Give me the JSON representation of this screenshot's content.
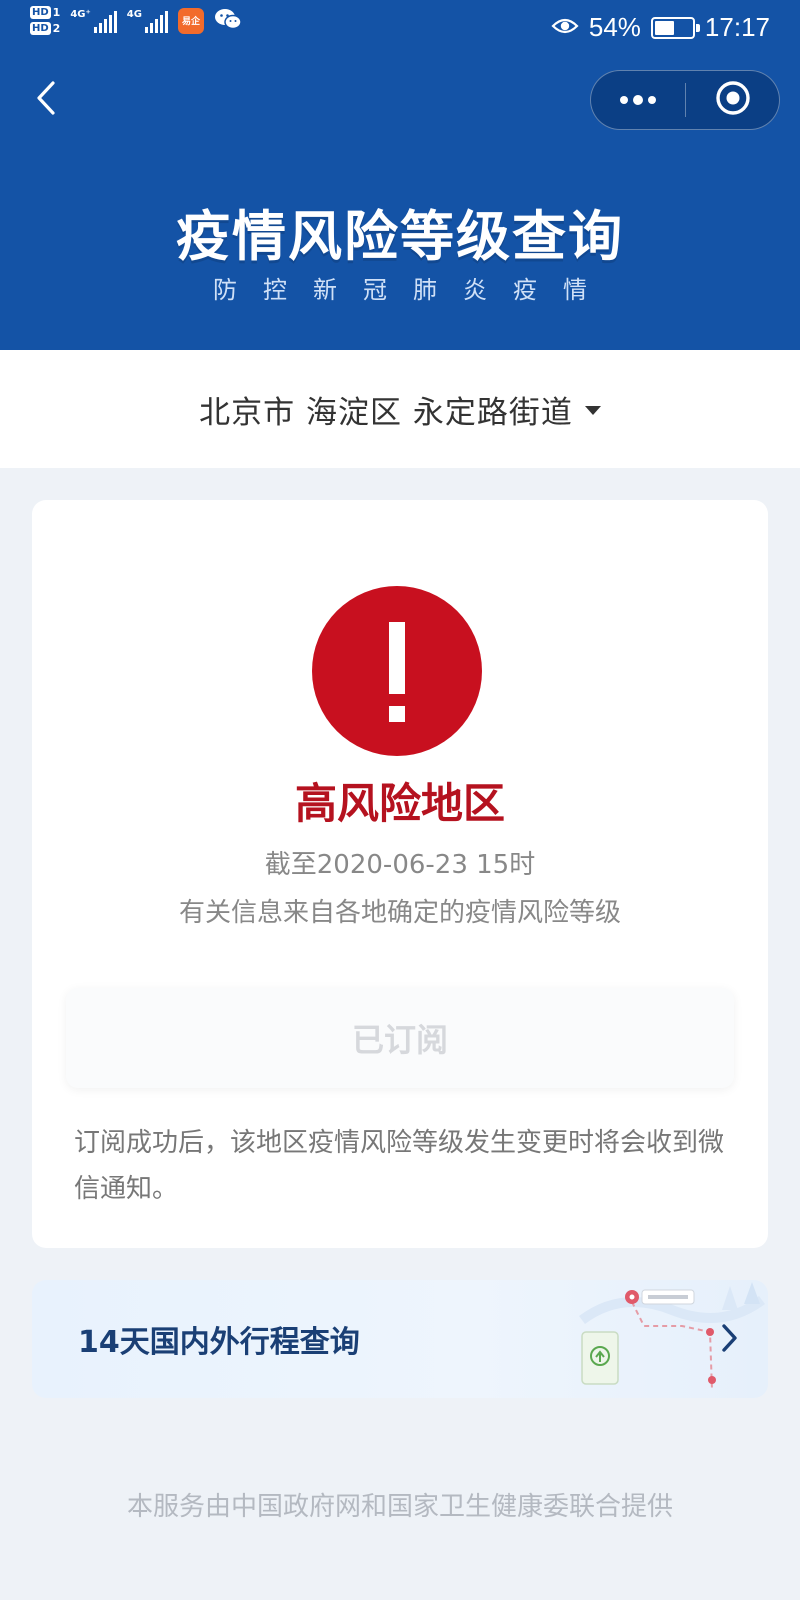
{
  "status_bar": {
    "hd1": "HD",
    "hd1_slot": "1",
    "hd2": "HD",
    "hd2_slot": "2",
    "signal1_label": "4G⁺",
    "signal2_label": "4G",
    "app_badge": "易企",
    "battery_percent": "54%",
    "battery_level": 0.54,
    "time": "17:17"
  },
  "nav": {
    "back_icon": "chevron-left-icon",
    "more_icon": "more-dots-icon",
    "close_icon": "target-close-icon"
  },
  "banner": {
    "title": "疫情风险等级查询",
    "subtitle": "防控新冠肺炎疫情"
  },
  "location": {
    "text": "北京市 海淀区 永定路街道"
  },
  "risk": {
    "icon": "exclamation-icon",
    "level": "高风险地区",
    "time": "截至2020-06-23 15时",
    "source": "有关信息来自各地确定的疫情风险等级",
    "subscribe_label": "已订阅",
    "note": "订阅成功后，该地区疫情风险等级发生变更时将会收到微信通知。"
  },
  "trip": {
    "label": "14天国内外行程查询"
  },
  "footer": {
    "text": "本服务由中国政府网和国家卫生健康委联合提供"
  },
  "colors": {
    "header_bg": "#1453a6",
    "alert_red": "#c8101f",
    "risk_text": "#b5121f",
    "page_bg": "#eef2f7"
  }
}
